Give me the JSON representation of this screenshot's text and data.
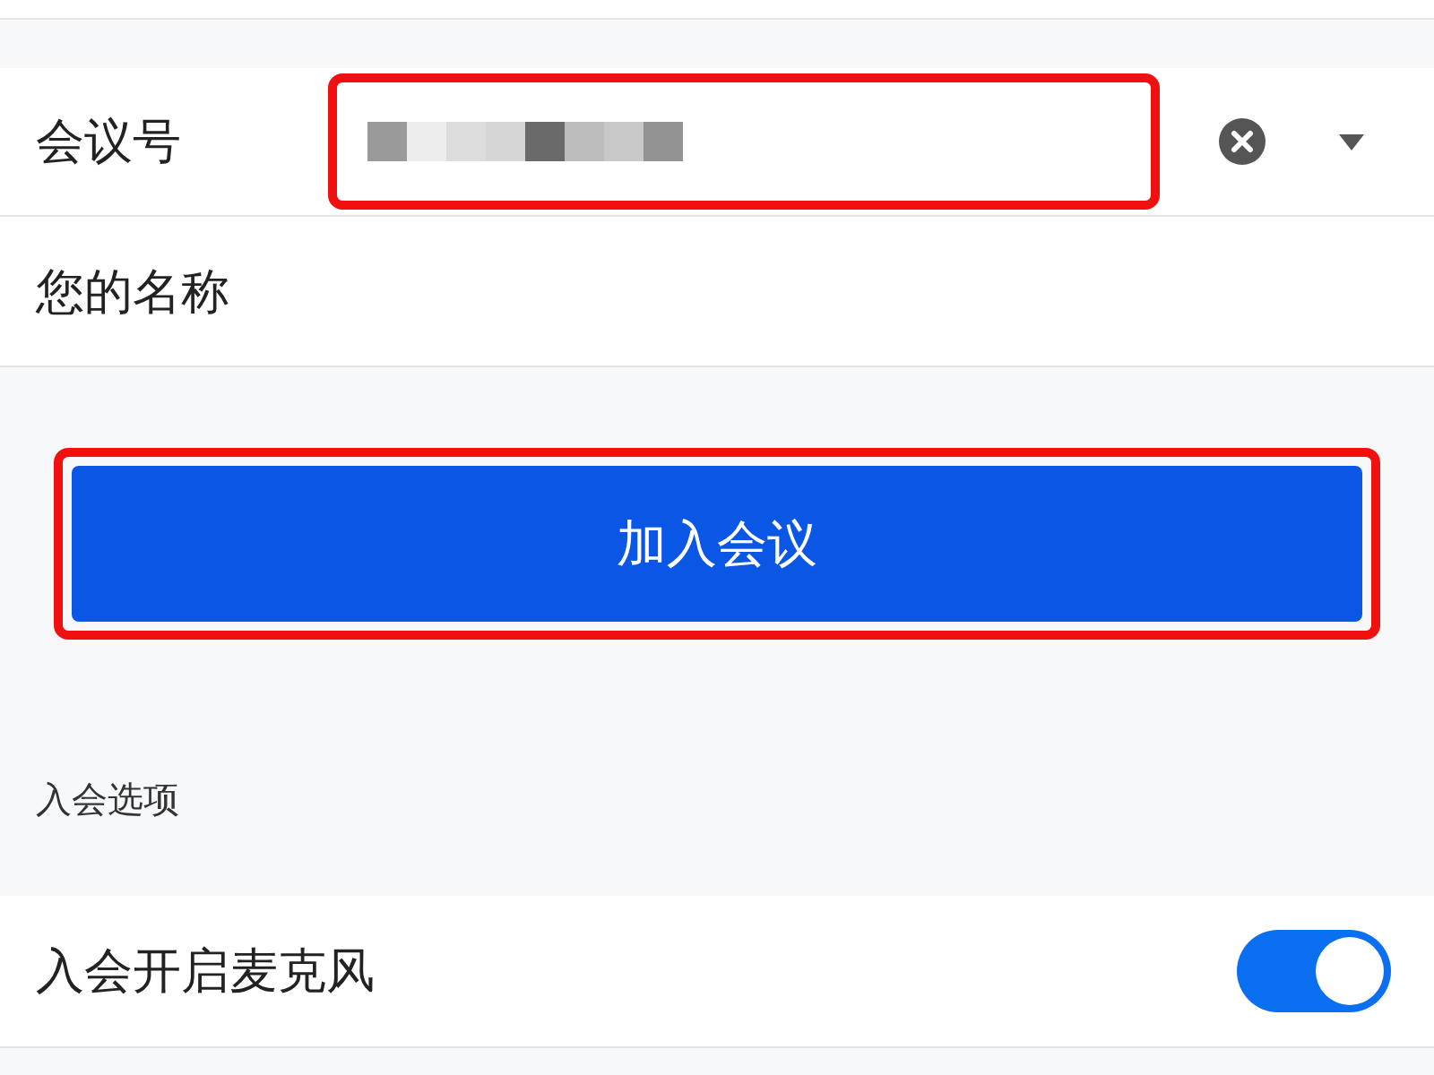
{
  "meeting_field": {
    "label": "会议号",
    "value_redacted": true,
    "highlighted": true
  },
  "name_field": {
    "label": "您的名称"
  },
  "join_button": {
    "label": "加入会议",
    "highlighted": true
  },
  "options_section": {
    "title": "入会选项"
  },
  "options": [
    {
      "kind": "toggle",
      "label": "入会开启麦克风",
      "on": true
    }
  ]
}
